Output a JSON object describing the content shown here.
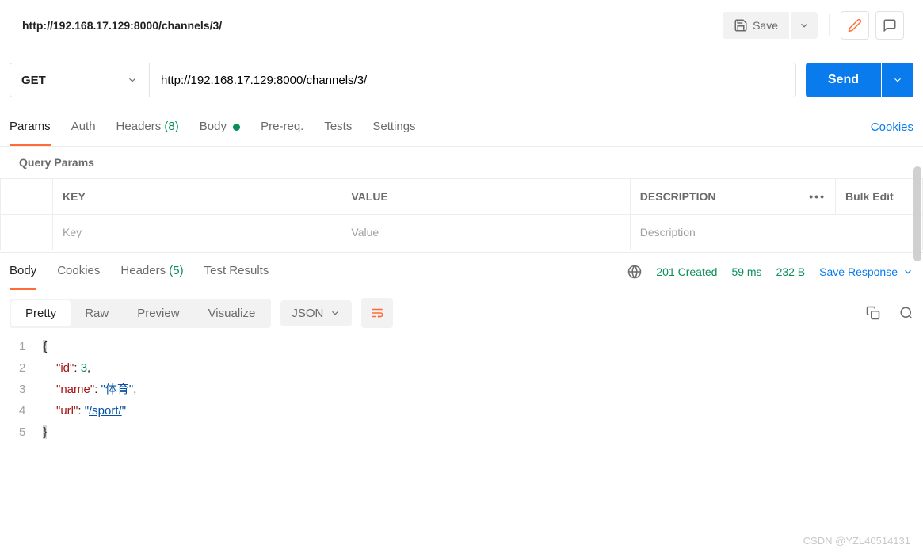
{
  "title": "http://192.168.17.129:8000/channels/3/",
  "toolbar": {
    "save_label": "Save"
  },
  "request": {
    "method": "GET",
    "url": "http://192.168.17.129:8000/channels/3/",
    "send_label": "Send"
  },
  "req_tabs": {
    "params": "Params",
    "auth": "Auth",
    "headers": "Headers",
    "headers_count": "(8)",
    "body": "Body",
    "prereq": "Pre-req.",
    "tests": "Tests",
    "settings": "Settings",
    "cookies": "Cookies"
  },
  "query_params": {
    "section_title": "Query Params",
    "key_header": "KEY",
    "value_header": "VALUE",
    "desc_header": "DESCRIPTION",
    "bulk_edit": "Bulk Edit",
    "key_placeholder": "Key",
    "value_placeholder": "Value",
    "desc_placeholder": "Description"
  },
  "resp_tabs": {
    "body": "Body",
    "cookies": "Cookies",
    "headers": "Headers",
    "headers_count": "(5)",
    "test_results": "Test Results"
  },
  "resp_meta": {
    "status": "201 Created",
    "time": "59 ms",
    "size": "232 B",
    "save_response": "Save Response"
  },
  "body_view": {
    "pretty": "Pretty",
    "raw": "Raw",
    "preview": "Preview",
    "visualize": "Visualize",
    "format": "JSON"
  },
  "response_body": {
    "line1": "{",
    "id_key": "\"id\"",
    "id_val": "3",
    "name_key": "\"name\"",
    "name_val": "\"体育\"",
    "url_key": "\"url\"",
    "url_val_q1": "\"",
    "url_val_inner": "/sport/",
    "url_val_q2": "\"",
    "line5": "}"
  },
  "line_nums": {
    "l1": "1",
    "l2": "2",
    "l3": "3",
    "l4": "4",
    "l5": "5"
  },
  "watermark": "CSDN @YZL40514131"
}
